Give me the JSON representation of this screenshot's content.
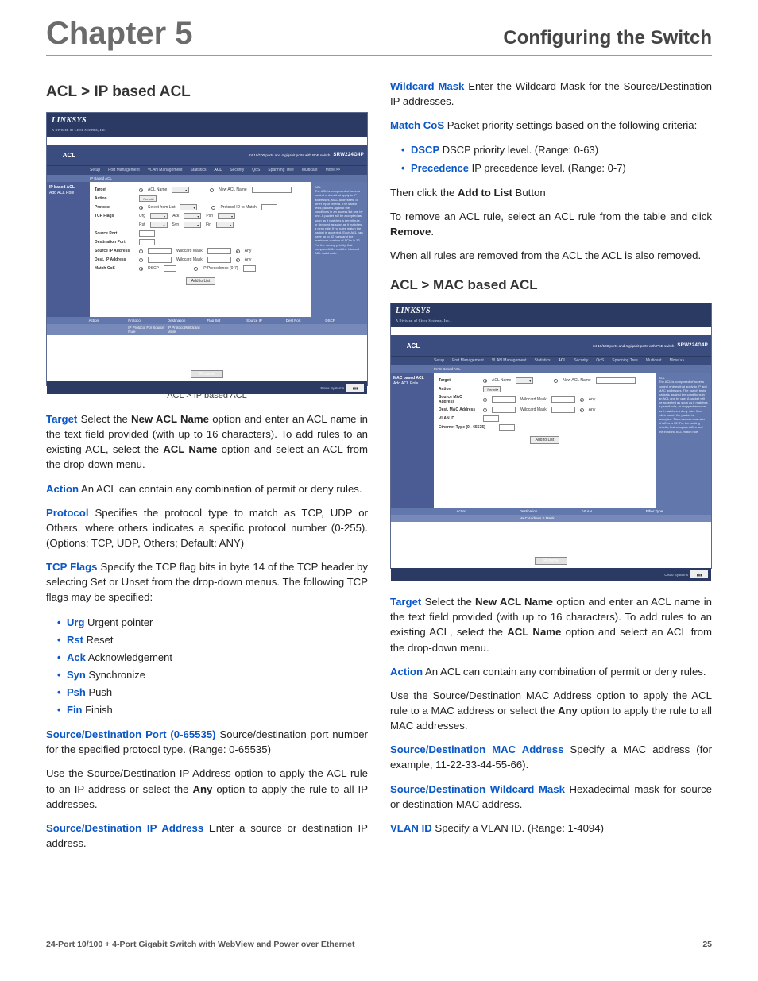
{
  "header": {
    "chapter": "Chapter 5",
    "title": "Configuring the Switch"
  },
  "left": {
    "heading": "ACL > IP based ACL",
    "caption": "ACL > IP based ACL",
    "p_target_label": "Target",
    "p_target_1": "  Select the ",
    "p_target_bold1": "New ACL Name",
    "p_target_2": " option and enter an ACL name in the text field provided (with up to 16 characters). To add rules to an existing ACL, select the ",
    "p_target_bold2": "ACL Name",
    "p_target_3": " option and select an ACL from the drop-down menu.",
    "p_action_label": "Action",
    "p_action": "  An ACL can contain any combination of permit or deny rules.",
    "p_protocol_label": "Protocol",
    "p_protocol": "  Specifies the protocol type to match as TCP, UDP or Others, where others indicates a specific protocol number (0-255). (Options: TCP, UDP, Others; Default: ANY)",
    "p_tcpflags_label": "TCP Flags",
    "p_tcpflags": "  Specify the TCP flag bits in byte 14 of the TCP header by selecting Set or Unset from the drop-down menus.  The following TCP flags may be specified:",
    "flags": [
      {
        "name": "Urg",
        "desc": "  Urgent pointer"
      },
      {
        "name": "Rst",
        "desc": "  Reset"
      },
      {
        "name": "Ack",
        "desc": "  Acknowledgement"
      },
      {
        "name": "Syn",
        "desc": "  Synchronize"
      },
      {
        "name": "Psh",
        "desc": "  Push"
      },
      {
        "name": "Fin",
        "desc": "  Finish"
      }
    ],
    "p_srcdstport_label": "Source/Destination Port (0-65535)",
    "p_srcdstport": "  Source/destination port number for the specified protocol type. (Range: 0-65535)",
    "p_usesrcdstip_1": "Use the Source/Destination IP Address option to apply the ACL rule to an IP address or select the ",
    "p_usesrcdstip_bold": "Any",
    "p_usesrcdstip_2": " option to apply the rule to all IP addresses.",
    "p_srcdstip_label": "Source/Destination IP Address",
    "p_srcdstip": " Enter a source or destination IP address."
  },
  "right": {
    "p_wildcard_label": "Wildcard Mask",
    "p_wildcard": "  Enter the Wildcard Mask for the Source/Destination IP addresses.",
    "p_matchcos_label": "Match CoS",
    "p_matchcos": "   Packet priority settings based on the following criteria:",
    "cos_items": [
      {
        "name": "DSCP",
        "desc": "  DSCP priority level. (Range: 0-63)"
      },
      {
        "name": "Precedence",
        "desc": "  IP precedence level. (Range: 0-7)"
      }
    ],
    "p_addtolist_1": "Then click the ",
    "p_addtolist_bold": "Add to List",
    "p_addtolist_2": " Button",
    "p_remove_1": "To remove an ACL rule, select an ACL rule from the table and click ",
    "p_remove_bold": "Remove",
    "p_remove_2": ".",
    "p_allremoved": "When all rules are removed from the ACL the ACL is also removed.",
    "heading2": "ACL > MAC based ACL",
    "caption2": "ACL > MAC based ACL",
    "p2_target_label": "Target",
    "p2_target_1": "  Select the ",
    "p2_target_bold1": "New ACL Name",
    "p2_target_2": " option and enter an ACL name in the text field provided (with up to 16 characters). To add rules to an existing ACL, select the ",
    "p2_target_bold2": "ACL Name",
    "p2_target_3": " option and select an ACL from the drop-down menu.",
    "p2_action_label": "Action",
    "p2_action": "   An ACL can contain any combination of permit or deny rules.",
    "p2_usemac_1": "Use the Source/Destination MAC Address option to apply the ACL rule to a MAC address or select the ",
    "p2_usemac_bold": "Any",
    "p2_usemac_2": " option to apply the rule to all MAC addresses.",
    "p2_srcdstmac_label": "Source/Destination MAC Address",
    "p2_srcdstmac": " Specify a MAC address (for example, 11-22-33-44-55-66).",
    "p2_wildcard_label": "Source/Destination Wildcard Mask",
    "p2_wildcard": "  Hexadecimal mask for source or destination MAC address.",
    "p2_vlan_label": "VLAN ID",
    "p2_vlan": "   Specify a VLAN ID. (Range: 1-4094)"
  },
  "mock_ip": {
    "brand": "LINKSYS",
    "brand_sub": "A Division of Cisco Systems, Inc.",
    "section": "ACL",
    "desc": "24 10/100 ports and 4 gigabit ports with PoE switch",
    "model": "SRW224G4P",
    "tabs": [
      "Setup",
      "Port Management",
      "VLAN Management",
      "Statistics",
      "ACL",
      "Security",
      "QoS",
      "Spanning Tree",
      "Multicast",
      "More >>"
    ],
    "subtab": "IP Based ACL",
    "side1": "IP based ACL",
    "side2": "Add ACL Role",
    "labels": {
      "target": "Target",
      "aclname": "ACL Name",
      "newacl": "New ACL Name",
      "action": "Action",
      "permit": "Permit",
      "protocol": "Protocol",
      "selectfromlist": "Select from List",
      "protocolid": "Protocol ID to Match",
      "tcpflags": "TCP Flags",
      "urg": "Urg",
      "ack": "Ack",
      "psh": "Psh",
      "rst": "Rst",
      "syn": "Syn",
      "fin": "Fin",
      "srcport": "Source Port",
      "dstport": "Destination Port",
      "srcip": "Source IP Address",
      "wildcardmask": "Wildcard Mask",
      "any": "Any",
      "dstip": "Dest. IP Address",
      "matchcos": "Match CoS",
      "dscp": "DSCP",
      "ipprec": "IP Precedence (0-7)",
      "addtolist": "Add to List"
    },
    "gridcols": [
      "",
      "Action",
      "Protocol",
      "Destination",
      "Flag Set",
      "Source IP",
      "Dest Port",
      "DSCP"
    ],
    "row1": [
      "",
      "",
      "IP Protocol For Source Rule",
      "IP Protocol/Wildcard Mask",
      "",
      "",
      "",
      ""
    ],
    "removebtn": "Remove",
    "cisco": "Cisco Systems"
  },
  "mock_mac": {
    "brand": "LINKSYS",
    "brand_sub": "A Division of Cisco Systems, Inc.",
    "section": "ACL",
    "desc": "24 10/100 ports and 4 gigabit ports with PoE switch",
    "model": "SRW224G4P",
    "tabs": [
      "Setup",
      "Port Management",
      "VLAN Management",
      "Statistics",
      "ACL",
      "Security",
      "QoS",
      "Spanning Tree",
      "Multicast",
      "More >>"
    ],
    "subtab": "MAC Based ACL",
    "side1": "MAC based ACL",
    "side2": "Add ACL Role",
    "labels": {
      "target": "Target",
      "aclname": "ACL Name",
      "newacl": "New ACL Name",
      "action": "Action",
      "permit": "Permit",
      "srcmac": "Source MAC Address",
      "wildcardmask": "Wildcard Mask",
      "any": "Any",
      "dstmac": "Dest. MAC Address",
      "vlanid": "VLAN ID",
      "ethtype": "Ethernet Type (0 - 65535)",
      "addtolist": "Add to List"
    },
    "gridcols": [
      "",
      "Action",
      "Destination",
      "VLAN",
      "Ether Type"
    ],
    "row1": [
      "",
      "",
      "MAC Address & Mask",
      "",
      ""
    ],
    "removebtn": "Remove",
    "cisco": "Cisco Systems"
  },
  "footer": {
    "left": "24-Port 10/100 + 4-Port Gigabit Switch with WebView and Power over Ethernet",
    "right": "25"
  }
}
